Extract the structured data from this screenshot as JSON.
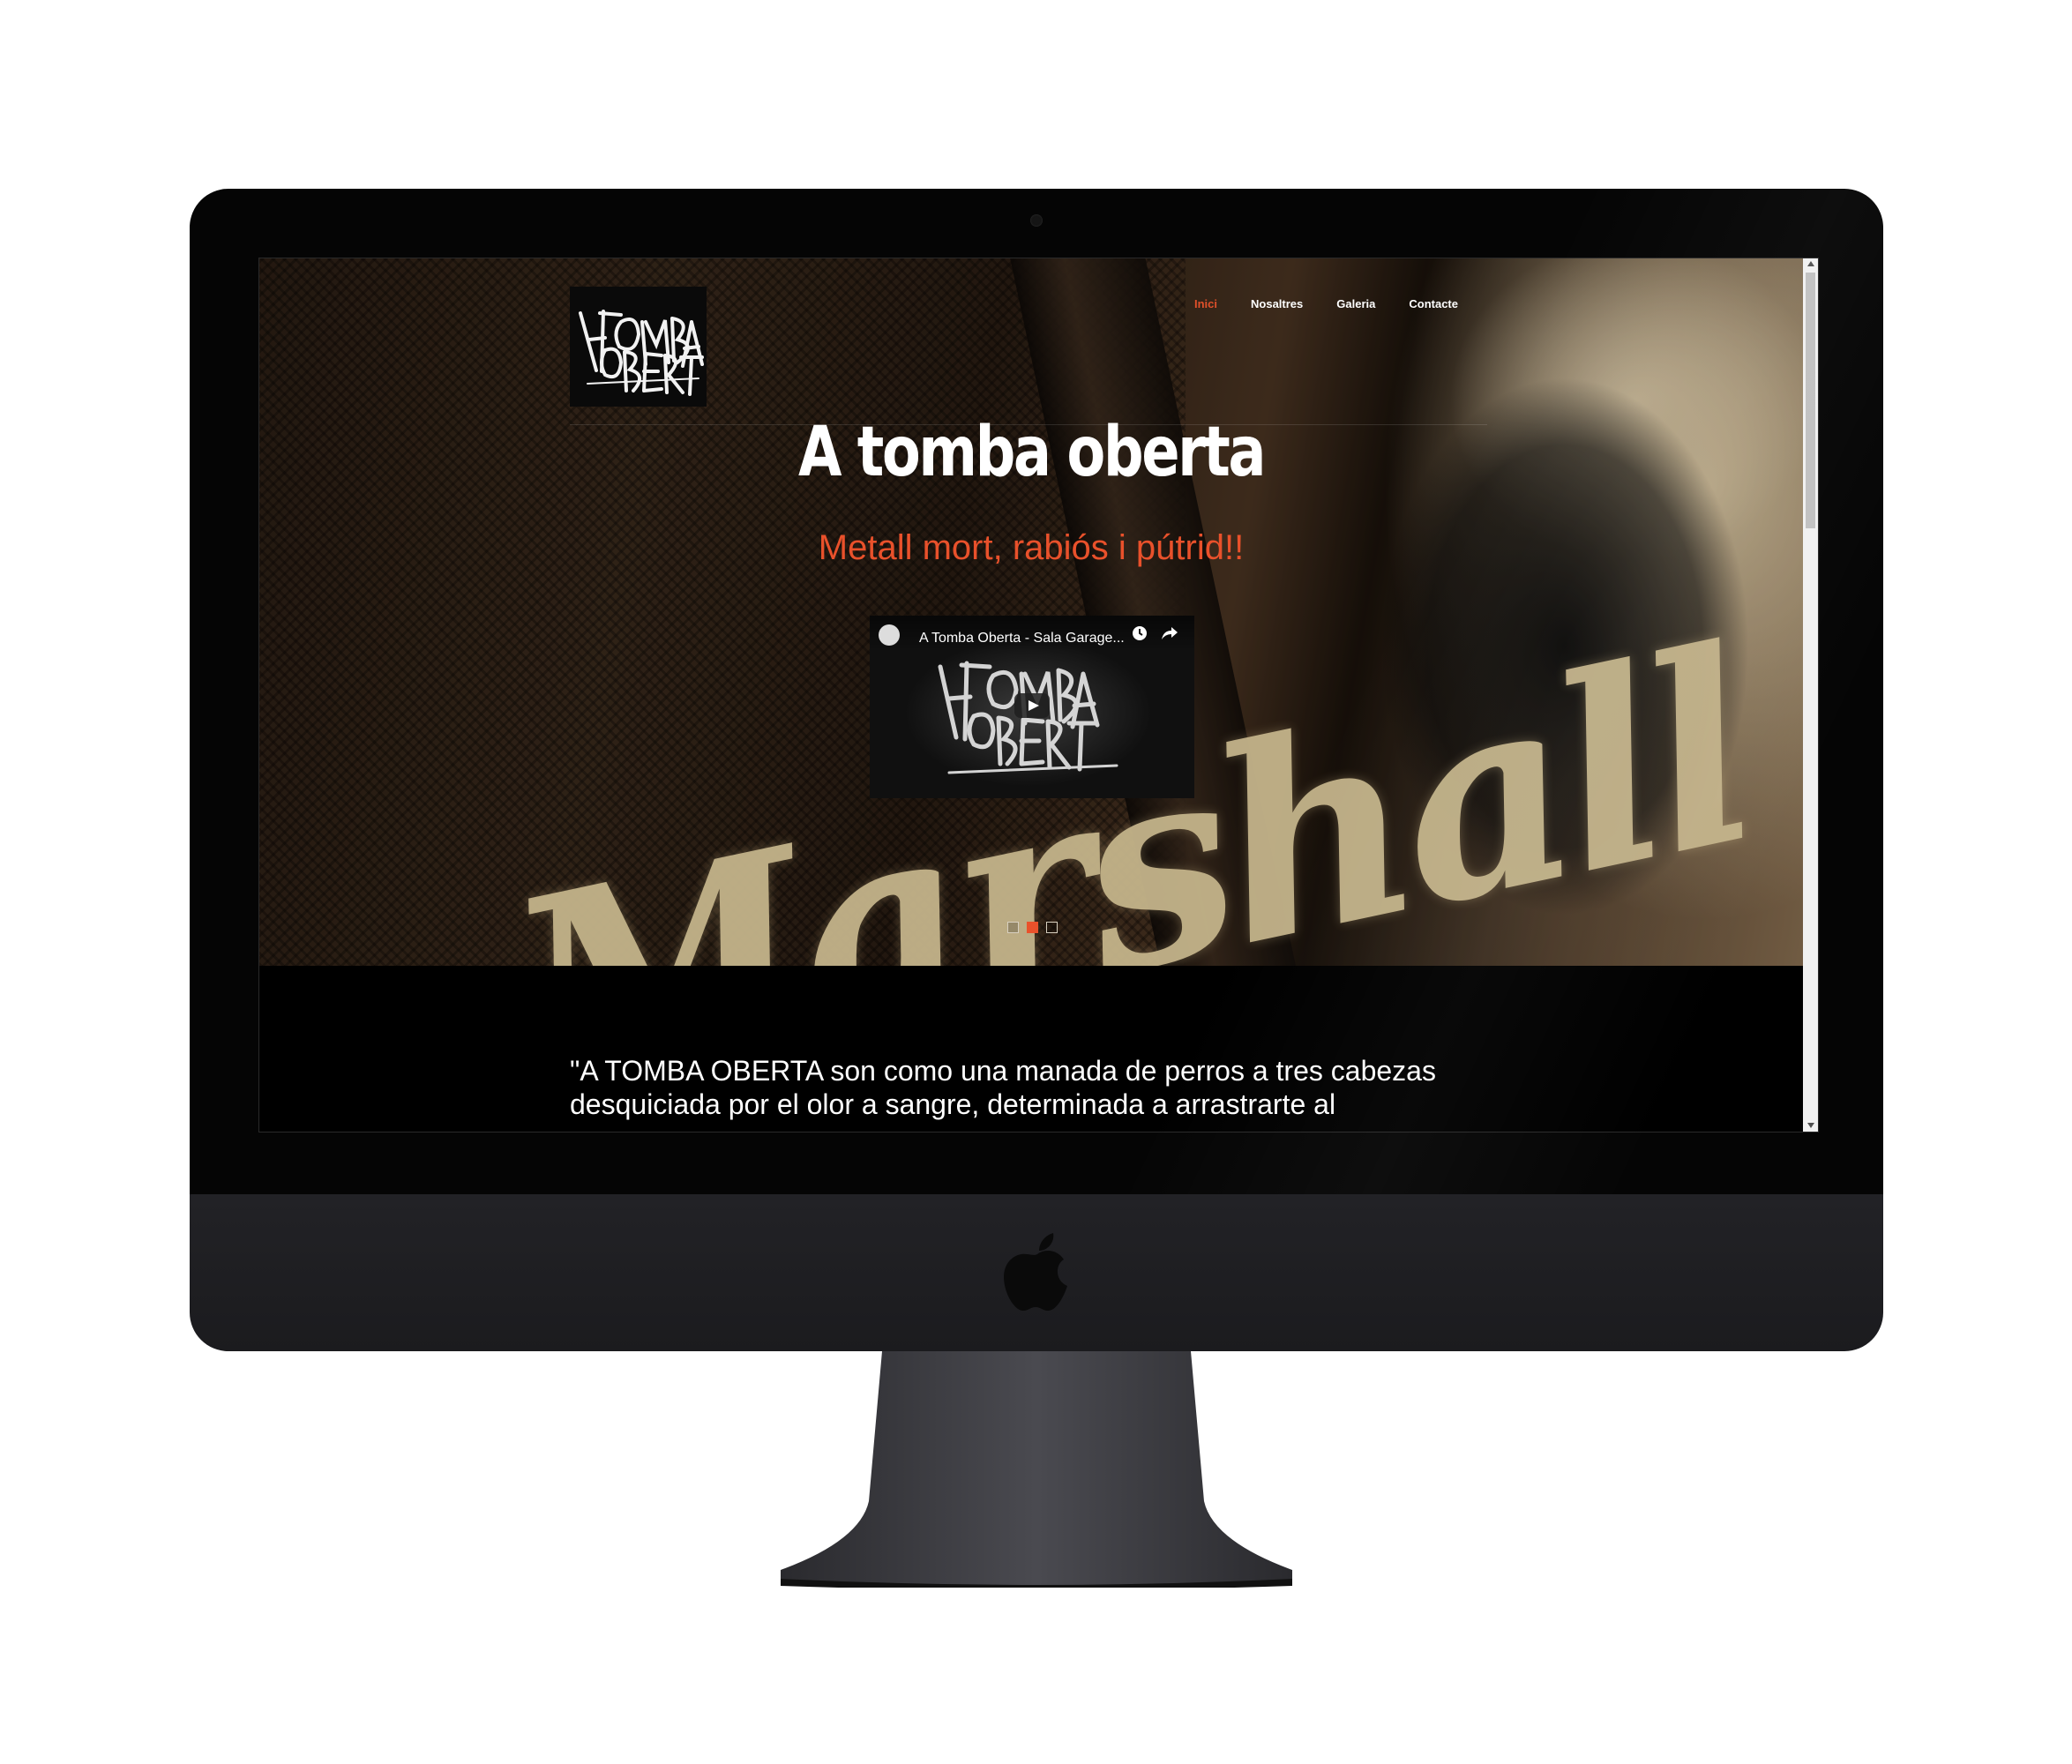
{
  "site": {
    "logo_text": "A TOMBA OBERTA",
    "nav": [
      {
        "label": "Inici",
        "active": true
      },
      {
        "label": "Nosaltres",
        "active": false
      },
      {
        "label": "Galeria",
        "active": false
      },
      {
        "label": "Contacte",
        "active": false
      }
    ],
    "hero": {
      "title": "A tomba oberta",
      "subtitle": "Metall mort, rabiós i pútrid!!",
      "background_text": "Marshall",
      "slider_dots": 3,
      "active_dot": 2
    },
    "video": {
      "title": "A Tomba Oberta - Sala Garage...",
      "play_icon": "play-icon",
      "clock_icon": "clock-icon",
      "share_icon": "share-icon"
    },
    "quote": "\"A TOMBA OBERTA son como una manada de perros a tres cabezas desquiciada por el olor a sangre, determinada a arrastrarte al"
  },
  "colors": {
    "accent": "#e9512b",
    "background": "#000000",
    "text": "#ffffff"
  }
}
